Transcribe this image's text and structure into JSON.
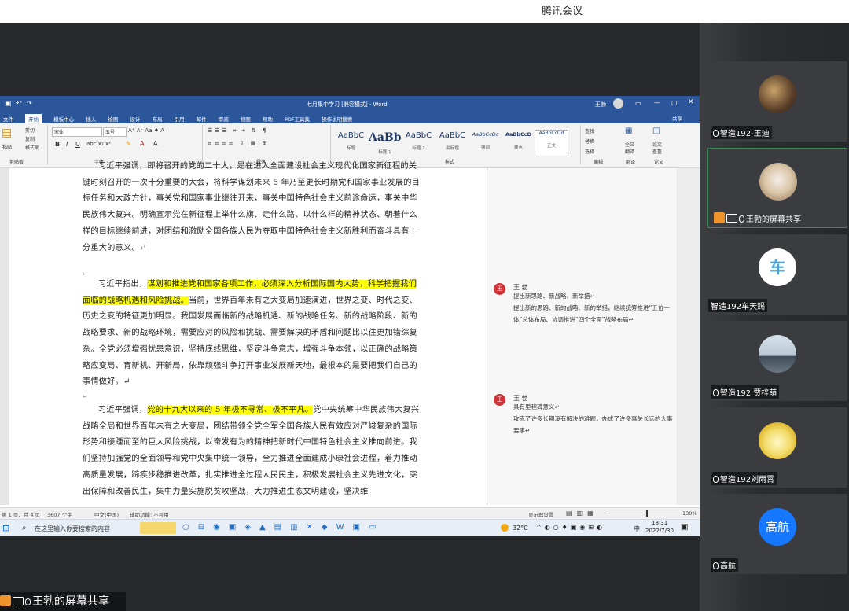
{
  "app_title": "腾讯会议",
  "word": {
    "window_title": "七月集中学习 [兼容模式] - Word",
    "user": "王勃",
    "tabs": [
      "文件",
      "开始",
      "模板中心",
      "插入",
      "绘图",
      "设计",
      "布局",
      "引用",
      "邮件",
      "审阅",
      "视图",
      "帮助",
      "PDF工具集",
      "操作说明搜索"
    ],
    "share_label": "共享",
    "ribbon": {
      "paste": "粘贴",
      "cut": "剪切",
      "copy": "复制",
      "format_painter": "格式刷",
      "clipboard": "剪贴板",
      "font_name": "宋体",
      "font_size": "五号",
      "font_group": "字体",
      "paragraph_group": "段落",
      "styles_group": "样式",
      "styles": [
        {
          "sample": "AaBbC",
          "name": "标题"
        },
        {
          "sample": "AaBb",
          "name": "标题 1"
        },
        {
          "sample": "AaBbC",
          "name": "标题 2"
        },
        {
          "sample": "AaBbC",
          "name": "副标题"
        },
        {
          "sample": "AaBbCcDc",
          "name": "强调"
        },
        {
          "sample": "AaBbCcD",
          "name": "要点"
        },
        {
          "sample": "AaBbCcDd",
          "name": "正文"
        }
      ],
      "find": "查找",
      "replace": "替换",
      "select": "选择",
      "editing_group": "编辑",
      "translate": "全文翻译",
      "translate_group": "翻译",
      "paper_check": "论文查重",
      "paper_group": "论文"
    },
    "document": {
      "paragraphs": [
        {
          "text": "习近平强调，即将召开的党的二十大，是在进入全面建设社会主义现代化国家新征程的关键时刻召开的一次十分重要的大会，将科学谋划未来 5 年乃至更长时期党和国家事业发展的目标任务和大政方针，事关党和国家事业继往开来，事关中国特色社会主义前途命运，事关中华民族伟大复兴。明确宣示党在新征程上举什么旗、走什么路、以什么样的精神状态、朝着什么样的目标继续前进，对团结和激励全国各族人民为夺取中国特色社会主义新胜利而奋斗具有十分重大的意义。↵"
        },
        {
          "pre": "习近平指出，",
          "highlight": "谋划和推进党和国家各项工作，必须深入分析国际国内大势，科学把握我们面临的战略机遇和风险挑战。",
          "post": "当前，世界百年未有之大变局加速演进，世界之变、时代之变、历史之变的特征更加明显。我国发展面临新的战略机遇、新的战略任务、新的战略阶段、新的战略要求、新的战略环境，需要应对的风险和挑战、需要解决的矛盾和问题比以往更加错综复杂。全党必须增强忧患意识，坚持底线思维，坚定斗争意志，增强斗争本领，以正确的战略策略应变局、育新机、开新局，依靠顽强斗争打开事业发展新天地，最根本的是要把我们自己的事情做好。↵"
        },
        {
          "pre": "习近平强调，",
          "highlight": "党的十九大以来的 5 年极不寻常、极不平凡。",
          "post": "党中央统筹中华民族伟大复兴战略全局和世界百年未有之大变局，团结带领全党全军全国各族人民有效应对严峻复杂的国际形势和接踵而至的巨大风险挑战，以奋发有为的精神把新时代中国特色社会主义推向前进。我们坚持加强党的全面领导和党中央集中统一领导，全力推进全面建成小康社会进程，着力推动高质量发展，蹄疾步稳推进改革，扎实推进全过程人民民主，积极发展社会主义先进文化，突出保障和改善民生，集中力量实施脱贫攻坚战，大力推进生态文明建设，坚决维"
        }
      ],
      "comments": [
        {
          "avatar": "王",
          "author": "王 勃",
          "title": "提出新思路、新战略、新举措↵",
          "body": "提出新的思路、新的战略、新的举措，继续统筹推进“五位一体”总体布局、协调推进“四个全面”战略布局↵"
        },
        {
          "avatar": "王",
          "author": "王 勃",
          "title": "具有里程碑意义↵",
          "body": "攻克了许多长期没有解决的难题，办成了许多事关长远的大事要事↵"
        }
      ]
    },
    "status": {
      "page": "第 1 页，共 4 页",
      "words": "3607 个字",
      "language": "中文(中国)",
      "accessibility": "辅助功能: 不可用",
      "display_settings": "显示器设置",
      "zoom": "130%"
    }
  },
  "taskbar": {
    "search_placeholder": "在这里输入你要搜索的内容",
    "weather": "32°C",
    "ime": "中",
    "time": "18:31",
    "date": "2022/7/30"
  },
  "participants": [
    {
      "name": "智造192-王迪",
      "muted": true,
      "avatar_color": "#7a5c3a"
    },
    {
      "name": "王勃的屏幕共享",
      "muted": false,
      "sharing": true,
      "avatar_color": "#c9b9a4"
    },
    {
      "name": "智造192车天赐",
      "muted": false,
      "avatar_text": "车",
      "avatar_color": "#ffffff"
    },
    {
      "name": "智造192 贾梓萌",
      "muted": true,
      "avatar_color": "#b8c4cf"
    },
    {
      "name": "智造192刘雨霄",
      "muted": true,
      "avatar_color": "#f2e6a0"
    },
    {
      "name": "高航",
      "muted": true,
      "avatar_text": "高航",
      "avatar_color": "#1677ff"
    }
  ],
  "bottom_share_label": "王勃的屏幕共享"
}
